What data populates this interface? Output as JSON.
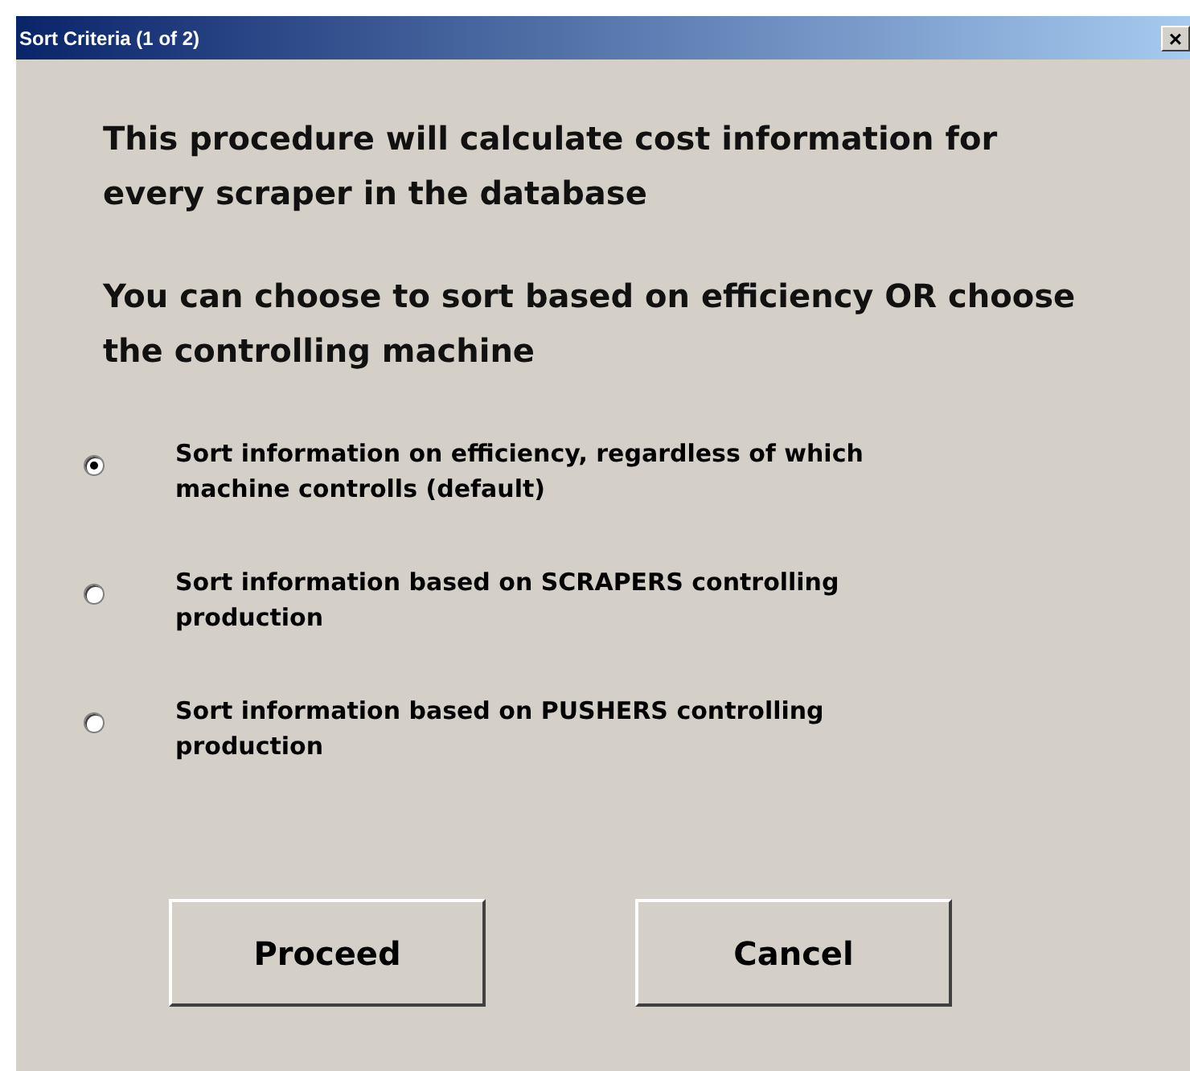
{
  "window": {
    "title": "Sort Criteria (1 of 2)",
    "close": "×"
  },
  "intro": [
    "This procedure will calculate cost information for every scraper in the database",
    "You can choose to sort based on efficiency OR choose the controlling machine"
  ],
  "options": [
    {
      "label": "Sort information on efficiency, regardless of which machine controlls (default)",
      "selected": true
    },
    {
      "label": "Sort information based on SCRAPERS controlling production",
      "selected": false
    },
    {
      "label": "Sort information based on PUSHERS controlling production",
      "selected": false
    }
  ],
  "buttons": [
    "Proceed",
    "Cancel"
  ]
}
